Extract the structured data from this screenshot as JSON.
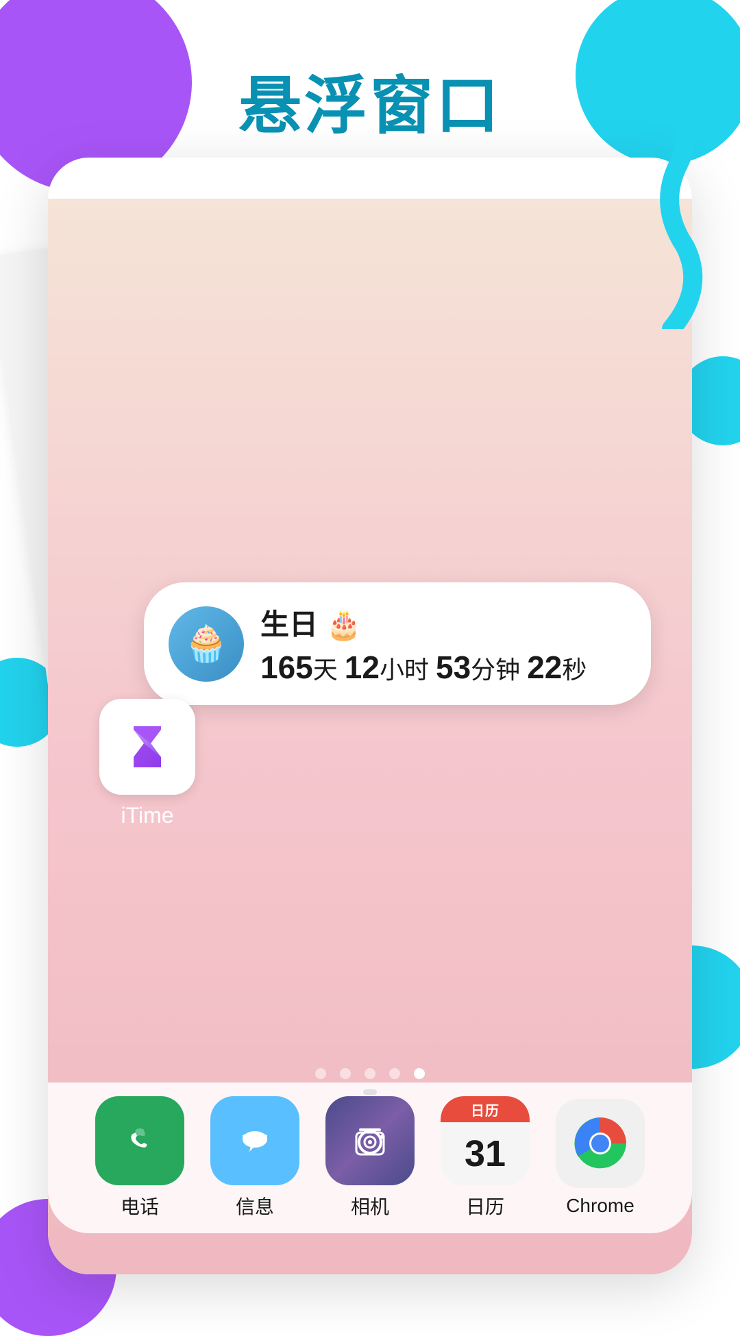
{
  "page": {
    "title": "悬浮窗口",
    "background_color": "#ffffff"
  },
  "widget": {
    "title": "生日 🎂",
    "countdown_days": "165天",
    "countdown_hours": "12小时",
    "countdown_minutes": "53分钟",
    "countdown_seconds": "22秒",
    "days_number": "165",
    "hours_number": "12",
    "minutes_number": "53",
    "seconds_number": "22"
  },
  "apps": {
    "itime_label": "iTime",
    "dock": [
      {
        "label": "电话",
        "id": "phone"
      },
      {
        "label": "信息",
        "id": "messages"
      },
      {
        "label": "相机",
        "id": "camera"
      },
      {
        "label": "日历",
        "id": "calendar"
      },
      {
        "label": "Chrome",
        "id": "chrome"
      }
    ],
    "calendar_date": "31"
  },
  "page_dots": {
    "total": 5,
    "active_index": 4
  }
}
